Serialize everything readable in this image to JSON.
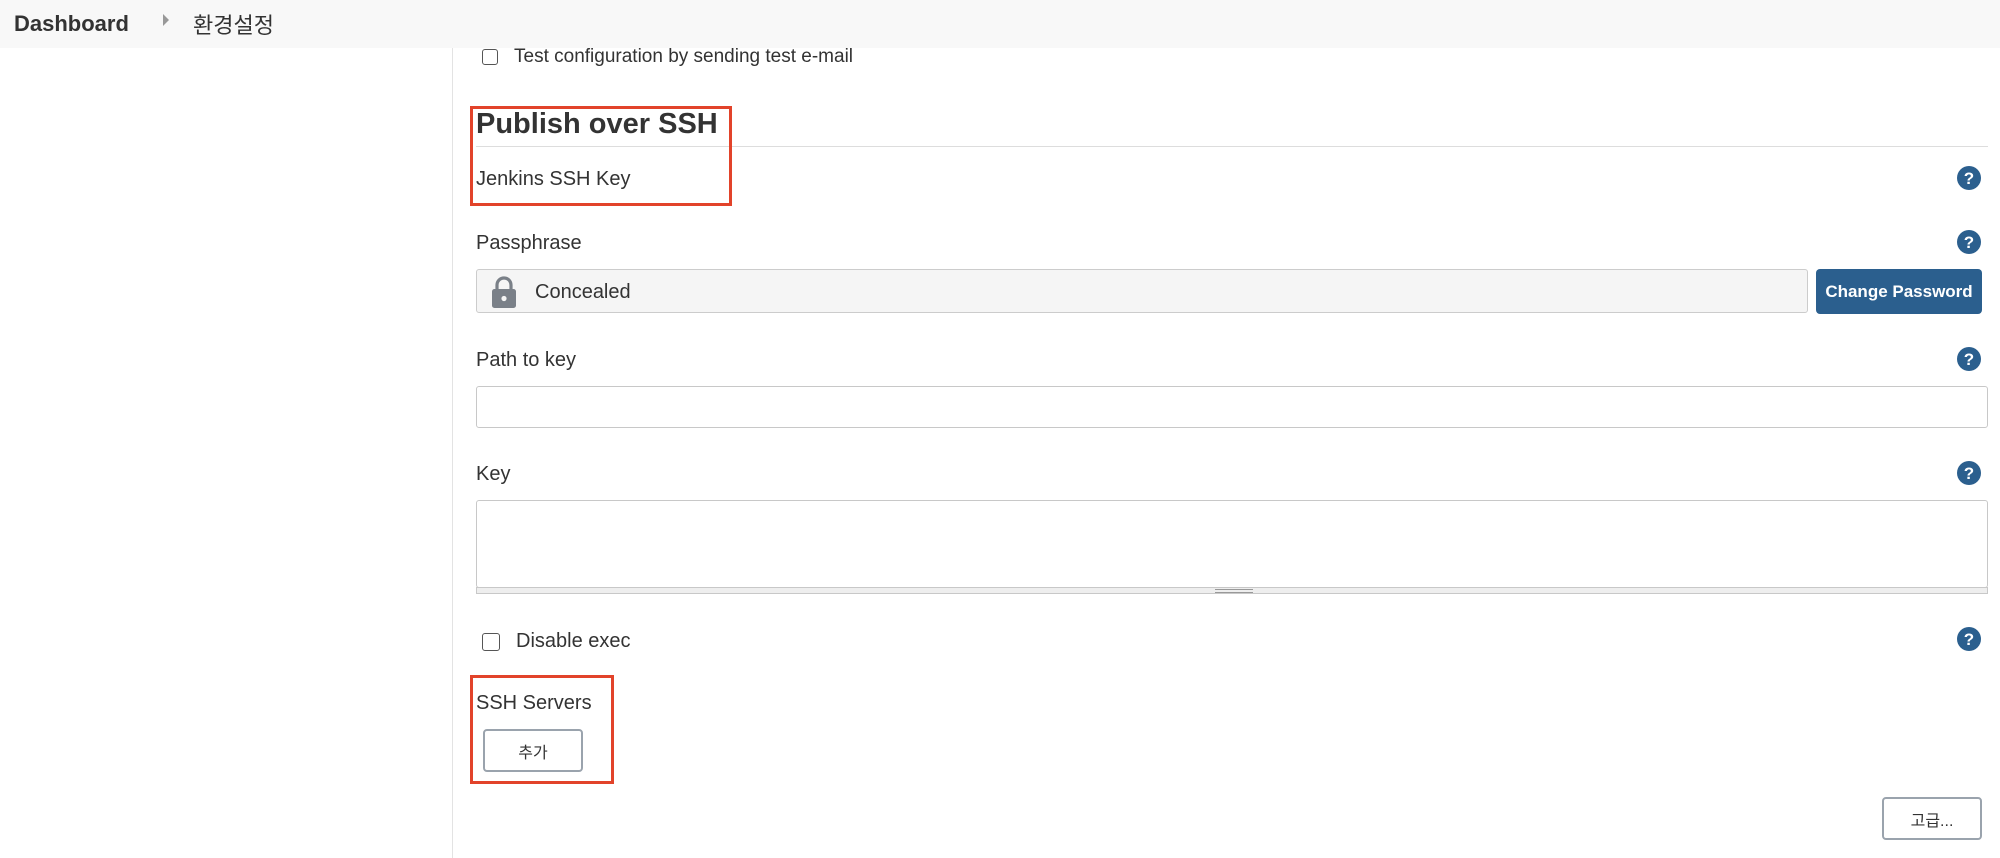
{
  "breadcrumb": {
    "home": "Dashboard",
    "current": "환경설정"
  },
  "email_test": {
    "checkbox_label": "Test configuration by sending test e-mail"
  },
  "publish_over_ssh": {
    "title": "Publish over SSH",
    "jenkins_ssh_key_label": "Jenkins SSH Key",
    "passphrase": {
      "label": "Passphrase",
      "value": "Concealed",
      "change_button": "Change Password"
    },
    "path_to_key": {
      "label": "Path to key",
      "value": ""
    },
    "key": {
      "label": "Key",
      "value": ""
    },
    "disable_exec_label": "Disable exec",
    "ssh_servers": {
      "label": "SSH Servers",
      "add_button": "추가"
    },
    "advanced_button": "고급...",
    "help_symbol": "?"
  },
  "colors": {
    "accent": "#2b5f8e",
    "highlight": "#e2432a"
  }
}
